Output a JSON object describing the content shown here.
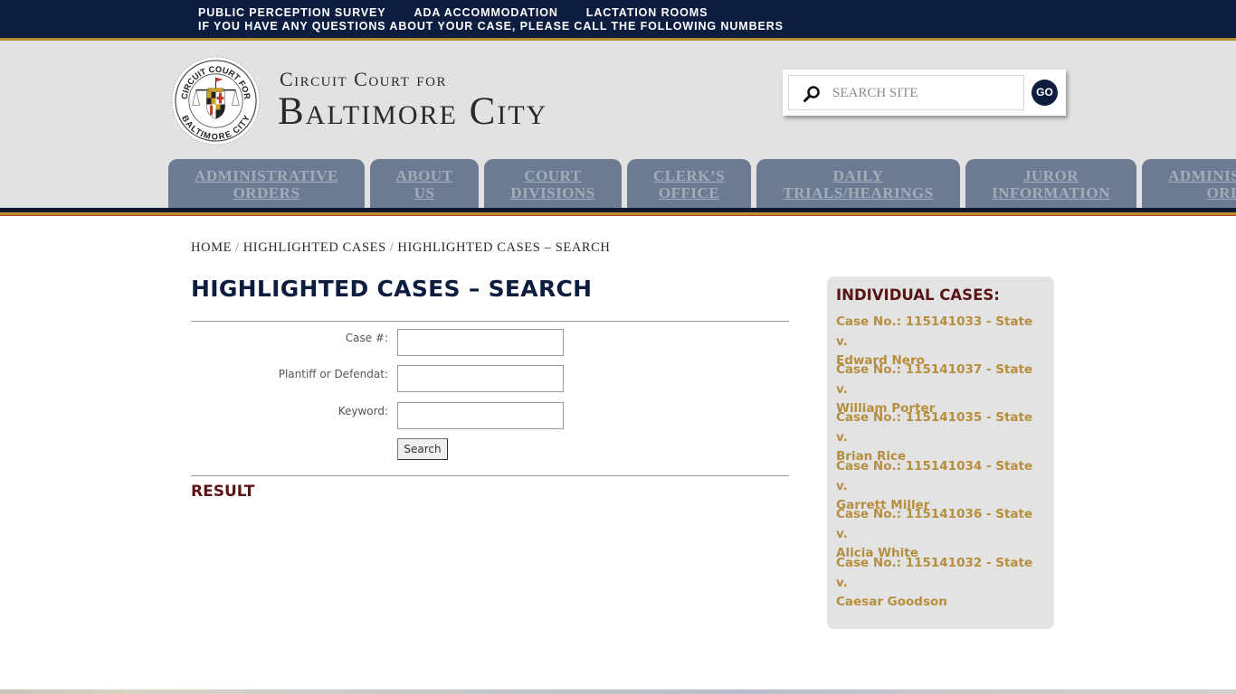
{
  "topbar": {
    "links": [
      "PUBLIC PERCEPTION SURVEY",
      "ADA ACCOMMODATION",
      "LACTATION ROOMS"
    ],
    "notice": "IF YOU HAVE ANY QUESTIONS ABOUT YOUR CASE, PLEASE CALL THE FOLLOWING NUMBERS"
  },
  "brand": {
    "line1": "Circuit Court for",
    "line2": "Baltimore City",
    "seal_top_text": "CIRCUIT COURT FOR",
    "seal_bottom_text": "BALTIMORE CITY"
  },
  "site_search": {
    "placeholder": "SEARCH SITE",
    "value": "",
    "go_label": "GO",
    "icon": "search-icon"
  },
  "nav": {
    "items": [
      {
        "line1": "ADMINISTRATIVE",
        "line2": "ORDERS"
      },
      {
        "line1": "ABOUT",
        "line2": "US"
      },
      {
        "line1": "COURT",
        "line2": "DIVISIONS"
      },
      {
        "line1": "CLERK’S",
        "line2": "OFFICE"
      },
      {
        "line1": "DAILY",
        "line2": "TRIALS/HEARINGS"
      },
      {
        "line1": "JUROR",
        "line2": "INFORMATION"
      },
      {
        "line1": "ADMINISTRATIVE",
        "line2": "ORDERS"
      }
    ]
  },
  "breadcrumb": {
    "items": [
      "HOME",
      "HIGHLIGHTED CASES",
      "HIGHLIGHTED CASES – SEARCH"
    ],
    "separator": "/"
  },
  "page": {
    "title": "HIGHLIGHTED CASES – SEARCH",
    "result_heading": "RESULT"
  },
  "form": {
    "fields": [
      {
        "label": "Case #:",
        "value": ""
      },
      {
        "label": "Plantiff or Defendat:",
        "value": ""
      },
      {
        "label": "Keyword:",
        "value": ""
      }
    ],
    "submit_label": "Search"
  },
  "sidebar": {
    "title": "INDIVIDUAL CASES:",
    "cases": [
      {
        "line1": "Case No.: 115141033 - State v.",
        "line2": "Edward Nero"
      },
      {
        "line1": "Case No.: 115141037 - State v.",
        "line2": "William Porter"
      },
      {
        "line1": "Case No.: 115141035 - State v.",
        "line2": "Brian Rice"
      },
      {
        "line1": "Case No.: 115141034 - State v.",
        "line2": "Garrett Miller"
      },
      {
        "line1": "Case No.: 115141036 - State v.",
        "line2": "Alicia White"
      },
      {
        "line1": "Case No.: 115141032 - State v.",
        "line2": "Caesar Goodson"
      }
    ]
  },
  "colors": {
    "navy": "#0d1d3f",
    "gold": "#b68e2e",
    "maroon": "#5a1414",
    "link_gold": "#b68e3e",
    "nav_tab": "#6c7a92",
    "header_bg": "#e2e2e2"
  }
}
